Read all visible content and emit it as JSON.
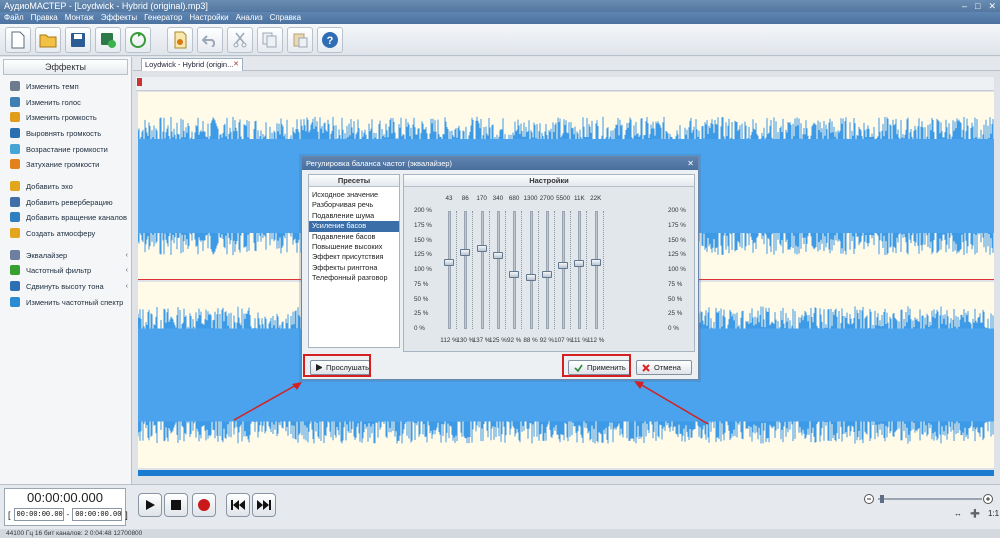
{
  "app": {
    "title": "АудиоМАСТЕР - [Loydwick - Hybrid (original).mp3]"
  },
  "menu": [
    "Файл",
    "Правка",
    "Монтаж",
    "Эффекты",
    "Генератор",
    "Настройки",
    "Анализ",
    "Справка"
  ],
  "toolbar": {
    "icons": [
      "new-file-icon",
      "open-folder-icon",
      "save-icon",
      "save-as-icon",
      "refresh-icon",
      "record-voice-icon",
      "undo-icon",
      "cut-icon",
      "copy-icon",
      "paste-icon",
      "help-icon"
    ]
  },
  "left_panel": {
    "header": "Эффекты",
    "items": [
      {
        "label": "Изменить темп",
        "color": "#6c7c8c"
      },
      {
        "label": "Изменить голос",
        "color": "#3f7fb3"
      },
      {
        "label": "Изменить громкость",
        "color": "#e39b1b"
      },
      {
        "label": "Выровнять громкость",
        "color": "#2a6fb0"
      },
      {
        "label": "Возрастание громкости",
        "color": "#47a5d6"
      },
      {
        "label": "Затухание громкости",
        "color": "#e3821b"
      },
      {
        "label": "Добавить эхо",
        "color": "#e3a51b"
      },
      {
        "label": "Добавить реверберацию",
        "color": "#3e6fa8"
      },
      {
        "label": "Добавить вращение каналов",
        "color": "#2d7fbf"
      },
      {
        "label": "Создать атмосферу",
        "color": "#e3a51b"
      },
      {
        "label": "Эквалайзер",
        "color": "#6c7fa0"
      },
      {
        "label": "Частотный фильтр",
        "color": "#36a032"
      },
      {
        "label": "Сдвинуть высоту тона",
        "color": "#2d6fb5"
      },
      {
        "label": "Изменить частотный спектр",
        "color": "#2a8bd0"
      }
    ]
  },
  "tab": {
    "label": "Loydwick - Hybrid (origin..."
  },
  "dialog": {
    "title": "Регулировка баланса частот (эквалайзер)",
    "presets_header": "Пресеты",
    "settings_header": "Настройки",
    "presets": [
      "Исходное значение",
      "Разборчивая речь",
      "Подавление шума",
      "Усиление басов",
      "Подавление басов",
      "Повышение высоких",
      "Эффект присутствия",
      "Эффекты рингтона",
      "Телефонный разговор"
    ],
    "selected_preset_index": 3,
    "levels": [
      "200 %",
      "175 %",
      "150 %",
      "125 %",
      "100 %",
      "75 %",
      "50 %",
      "25 %",
      "0 %"
    ],
    "bands": [
      {
        "freq": "43",
        "value": "112 %",
        "level": 112
      },
      {
        "freq": "86",
        "value": "130 %",
        "level": 130
      },
      {
        "freq": "170",
        "value": "137 %",
        "level": 137
      },
      {
        "freq": "340",
        "value": "125 %",
        "level": 125
      },
      {
        "freq": "680",
        "value": "92 %",
        "level": 92
      },
      {
        "freq": "1300",
        "value": "88 %",
        "level": 88
      },
      {
        "freq": "2700",
        "value": "92 %",
        "level": 92
      },
      {
        "freq": "5500",
        "value": "107 %",
        "level": 107
      },
      {
        "freq": "11K",
        "value": "111 %",
        "level": 111
      },
      {
        "freq": "22K",
        "value": "112 %",
        "level": 112
      }
    ],
    "listen_label": "Прослушать",
    "apply_label": "Применить",
    "cancel_label": "Отмена"
  },
  "transport": {
    "time": "00:00:00.000",
    "start": "00:00:00.000",
    "end": "00:00:00.000"
  },
  "status": "44100 Гц  16 бит  каналов: 2   0:04:48  12700800"
}
